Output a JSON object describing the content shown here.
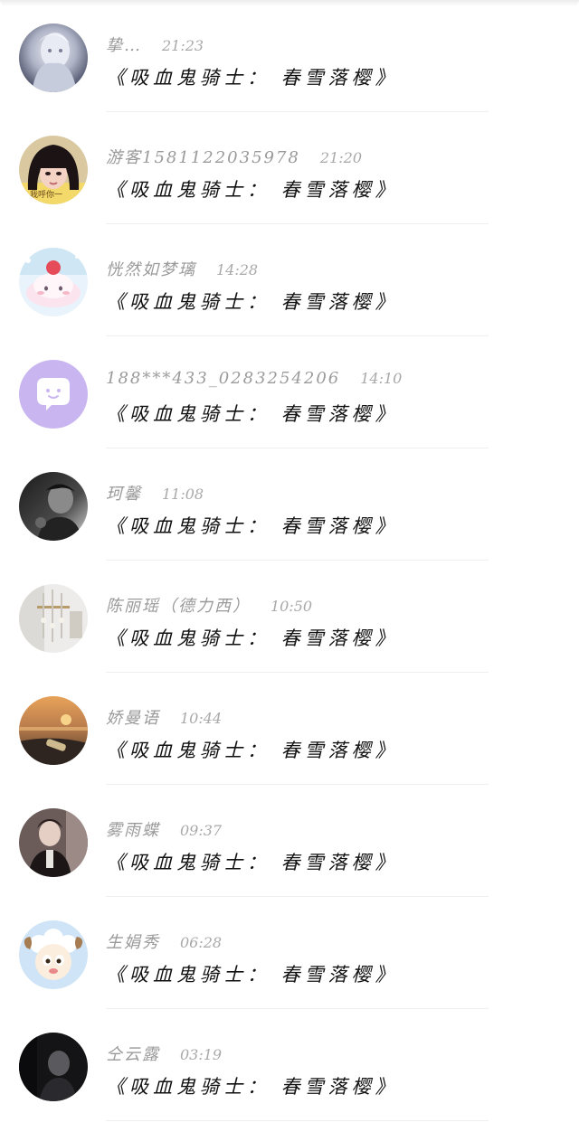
{
  "messages": [
    {
      "name": "挚…",
      "time": "21:23",
      "text": "《吸血鬼骑士： 春雪落樱》",
      "avatar": "silver-hair-avatar"
    },
    {
      "name": "游客1581122035978",
      "time": "21:20",
      "text": "《吸血鬼骑士： 春雪落樱》",
      "avatar": "girl-bangs-avatar"
    },
    {
      "name": "恍然如梦璃",
      "time": "14:28",
      "text": "《吸血鬼骑士： 春雪落樱》",
      "avatar": "pastel-dessert-avatar"
    },
    {
      "name": "188***433_0283254206",
      "time": "14:10",
      "text": "《吸血鬼骑士： 春雪落樱》",
      "avatar": "default-chat-bubble-avatar"
    },
    {
      "name": "珂馨",
      "time": "11:08",
      "text": "《吸血鬼骑士： 春雪落樱》",
      "avatar": "dark-portrait-avatar"
    },
    {
      "name": "陈丽瑶（德力西）",
      "time": "10:50",
      "text": "《吸血鬼骑士： 春雪落樱》",
      "avatar": "chandelier-avatar"
    },
    {
      "name": "娇曼语",
      "time": "10:44",
      "text": "《吸血鬼骑士： 春雪落樱》",
      "avatar": "sunset-beach-bottle-avatar"
    },
    {
      "name": "雾雨蝶",
      "time": "09:37",
      "text": "《吸血鬼骑士： 春雪落樱》",
      "avatar": "man-portrait-avatar"
    },
    {
      "name": "生娟秀",
      "time": "06:28",
      "text": "《吸血鬼骑士： 春雪落樱》",
      "avatar": "cartoon-sheep-avatar"
    },
    {
      "name": "仝云露",
      "time": "03:19",
      "text": "《吸血鬼骑士： 春雪落樱》",
      "avatar": "dark-figure-avatar"
    }
  ],
  "colors": {
    "name_text": "#9a9a9a",
    "time_text": "#a9a9a9",
    "message_text": "#111111",
    "divider": "#efefef",
    "default_avatar_bg": "#c9b6f1"
  }
}
